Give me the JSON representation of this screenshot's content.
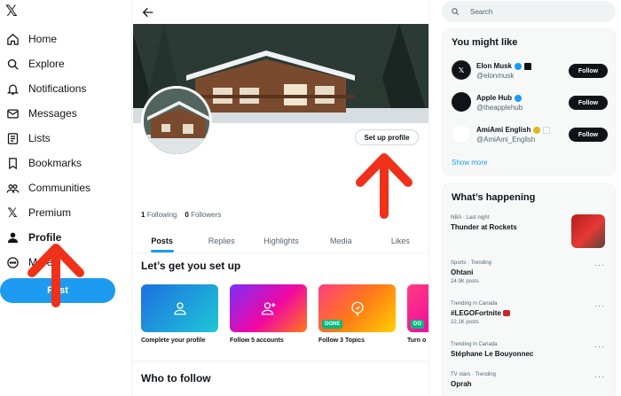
{
  "nav": {
    "logo": "𝕏",
    "items": [
      {
        "label": "Home",
        "icon": "home-icon"
      },
      {
        "label": "Explore",
        "icon": "search-icon"
      },
      {
        "label": "Notifications",
        "icon": "bell-icon"
      },
      {
        "label": "Messages",
        "icon": "mail-icon"
      },
      {
        "label": "Lists",
        "icon": "list-icon"
      },
      {
        "label": "Bookmarks",
        "icon": "bookmark-icon"
      },
      {
        "label": "Communities",
        "icon": "people-icon"
      },
      {
        "label": "Premium",
        "icon": "x-logo-icon"
      },
      {
        "label": "Profile",
        "icon": "person-icon"
      },
      {
        "label": "More",
        "icon": "more-circle-icon"
      }
    ],
    "post_label": "Post"
  },
  "profile": {
    "setup_button": "Set up profile",
    "following_count": "1",
    "following_label": "Following",
    "followers_count": "0",
    "followers_label": "Followers",
    "tabs": [
      "Posts",
      "Replies",
      "Highlights",
      "Media",
      "Likes"
    ],
    "active_tab": "Posts",
    "setup_title": "Let’s get you set up",
    "cards": [
      {
        "label": "Complete your profile",
        "done": ""
      },
      {
        "label": "Follow 5 accounts",
        "done": ""
      },
      {
        "label": "Follow 3 Topics",
        "done": "DONE"
      },
      {
        "label": "Turn o",
        "done": "DO"
      }
    ],
    "who_to_follow": "Who to follow"
  },
  "right": {
    "search_placeholder": "Search",
    "you_might_like": "You might like",
    "accounts": [
      {
        "name": "Elon Musk",
        "handle": "@elonmusk",
        "follow": "Follow"
      },
      {
        "name": "Apple Hub",
        "handle": "@theapplehub",
        "follow": "Follow"
      },
      {
        "name": "AmiAmi English",
        "handle": "@AmiAmi_English",
        "follow": "Follow"
      }
    ],
    "show_more": "Show more",
    "whats_happening": "What’s happening",
    "trends": [
      {
        "meta": "NBA · Last night",
        "title": "Thunder at Rockets",
        "count": ""
      },
      {
        "meta": "Sports · Trending",
        "title": "Ohtani",
        "count": "24.9K posts"
      },
      {
        "meta": "Trending in Canada",
        "title": "#LEGOFortnite",
        "count": "22.1K posts"
      },
      {
        "meta": "Trending in Canada",
        "title": "Stéphane Le Bouyonnec",
        "count": ""
      },
      {
        "meta": "TV stars · Trending",
        "title": "Oprah",
        "count": ""
      }
    ],
    "trend_more": "···"
  },
  "colors": {
    "accent": "#1d9bf0",
    "annotation_arrow": "#f0311a"
  }
}
